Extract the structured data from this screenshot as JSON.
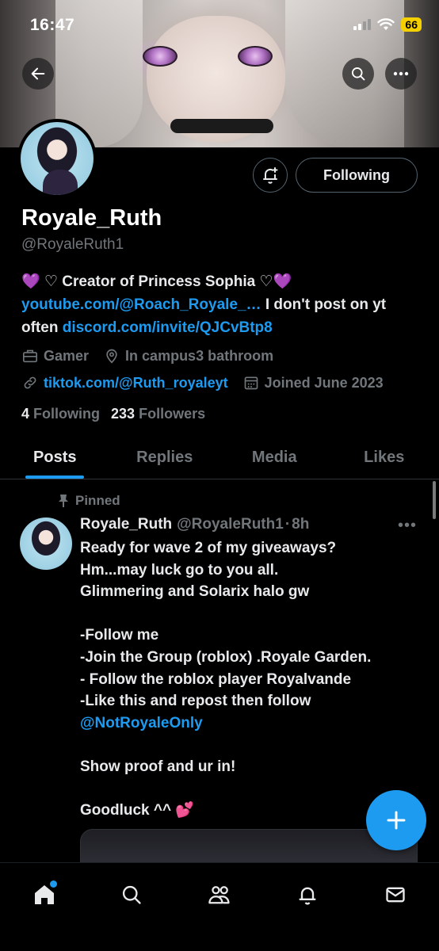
{
  "status_bar": {
    "time": "16:47",
    "battery": "66"
  },
  "header": {
    "back_icon": "arrow-left-icon",
    "search_icon": "search-icon",
    "more_icon": "more-horizontal-icon"
  },
  "profile": {
    "name": "Royale_Ruth",
    "handle": "@RoyaleRuth1",
    "following_button": "Following",
    "bio": {
      "line1_emoji_left": "💜",
      "line1_heart_left": "♡",
      "line1_text": "Creator of Princess Sophia",
      "line1_heart_right": "♡",
      "line1_emoji_right": "💜",
      "youtube_link": "youtube.com/@Roach_Royale_…",
      "youtube_after": "I don't post on yt often",
      "discord_link": "discord.com/invite/QJCvBtp8"
    },
    "category": "Gamer",
    "location": "In campus3 bathroom",
    "website": "tiktok.com/@Ruth_royaleyt",
    "joined": "Joined June 2023",
    "following_count": "4",
    "following_label": "Following",
    "followers_count": "233",
    "followers_label": "Followers"
  },
  "tabs": [
    {
      "label": "Posts",
      "active": true
    },
    {
      "label": "Replies",
      "active": false
    },
    {
      "label": "Media",
      "active": false
    },
    {
      "label": "Likes",
      "active": false
    }
  ],
  "pinned_post": {
    "pinned_label": "Pinned",
    "author_name": "Royale_Ruth",
    "author_handle": "@RoyaleRuth1",
    "separator": "·",
    "time": "8h",
    "text_intro": "Ready for wave 2 of my giveaways?\nHm...may luck go to you all.\nGlimmering and Solarix halo gw\n\n-Follow me\n-Join the Group (roblox) .Royale Garden.\n- Follow the roblox player Royalvande\n-Like this and repost then follow ",
    "mention": "@NotRoyaleOnly",
    "text_outro": "\n\nShow proof and ur in!\n\nGoodluck ^^ ",
    "outro_emoji": "💕"
  },
  "fab": {
    "icon": "plus-icon"
  },
  "bottom_nav": [
    {
      "name": "home-icon",
      "has_dot": true
    },
    {
      "name": "search-icon"
    },
    {
      "name": "communities-icon"
    },
    {
      "name": "notifications-icon"
    },
    {
      "name": "messages-icon"
    }
  ],
  "colors": {
    "accent": "#1d9bf0",
    "muted": "#71767b",
    "text": "#e7e9ea",
    "background": "#000000"
  }
}
